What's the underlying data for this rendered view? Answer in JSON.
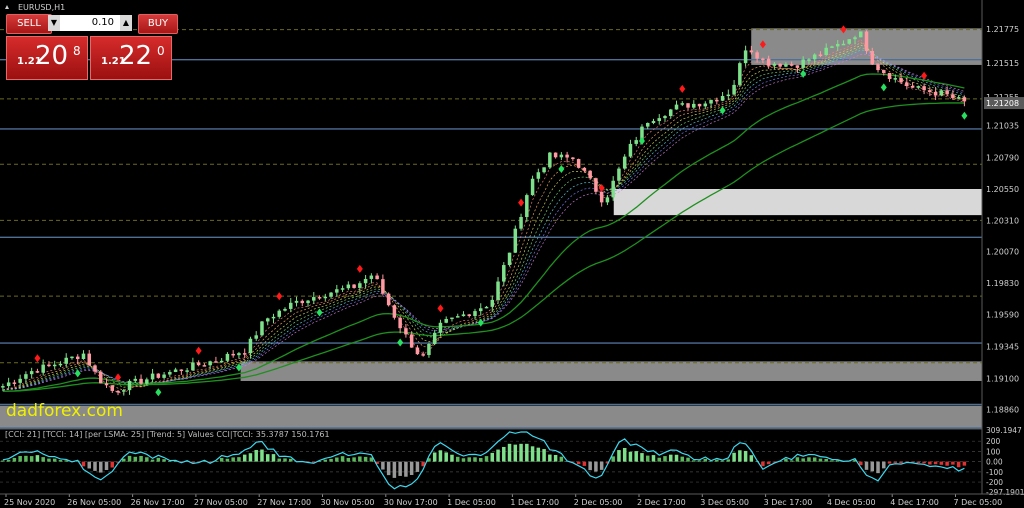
{
  "symbol_label": "EURUSD,H1",
  "watermark": "dadforex.com",
  "trade_panel": {
    "sell_label": "SELL",
    "buy_label": "BUY",
    "lot_value": "0.10",
    "sell_price_prefix": "1.21",
    "sell_price_big": "20",
    "sell_price_sup": "8",
    "buy_price_prefix": "1.21",
    "buy_price_big": "22",
    "buy_price_sup": "0",
    "arrow_down": "▼",
    "arrow_up": "▲"
  },
  "price_axis": [
    "1.21775",
    "1.21515",
    "1.21255",
    "1.21035",
    "1.20790",
    "1.20550",
    "1.20310",
    "1.20070",
    "1.19830",
    "1.19590",
    "1.19345",
    "1.19100",
    "1.18860"
  ],
  "current_price": "1.21208",
  "indicator": {
    "label": "[CCI: 21] [TCCI: 14] [per LSMA: 25] [Trend: 5] Values CCI|TCCI: 35.3787 150.1761",
    "axis_labels": [
      "309.1947",
      "200",
      "100",
      "0.00",
      "-100",
      "-200",
      "-297.1901"
    ]
  },
  "time_axis": [
    "25 Nov 2020",
    "26 Nov 05:00",
    "26 Nov 17:00",
    "27 Nov 05:00",
    "27 Nov 17:00",
    "30 Nov 05:00",
    "30 Nov 17:00",
    "1 Dec 05:00",
    "1 Dec 17:00",
    "2 Dec 05:00",
    "2 Dec 17:00",
    "3 Dec 05:00",
    "3 Dec 17:00",
    "4 Dec 05:00",
    "4 Dec 17:00",
    "7 Dec 05:00"
  ],
  "colors": {
    "background": "#000000",
    "bull_candle": "#7ee08a",
    "bear_candle": "#ff9aa2",
    "level_line": "#4e6f96",
    "dashed_level": "#6a6a20",
    "zone_fill": "#8a8a8a",
    "white_zone": "#d8d8d8",
    "sell_button": "#b11c1c",
    "cci_line": "#3cd9f0",
    "ma_green": "#1f8f1f",
    "up_marker": "#28e060",
    "down_marker": "#ff1a1a",
    "watermark": "#f0f000"
  },
  "icons": [
    "triangle-menu-icon",
    "diamond-marker-icon",
    "arrow-up-icon",
    "arrow-down-icon"
  ],
  "chart_data": {
    "type": "candlestick",
    "symbol": "EURUSD",
    "timeframe": "H1",
    "y_range": [
      1.1872,
      1.2189
    ],
    "x_labels": [
      "25 Nov 2020",
      "26 Nov 05:00",
      "26 Nov 17:00",
      "27 Nov 05:00",
      "27 Nov 17:00",
      "30 Nov 05:00",
      "30 Nov 17:00",
      "1 Dec 05:00",
      "1 Dec 17:00",
      "2 Dec 05:00",
      "2 Dec 17:00",
      "3 Dec 05:00",
      "3 Dec 17:00",
      "4 Dec 05:00",
      "4 Dec 17:00",
      "7 Dec 05:00"
    ],
    "close_path": [
      [
        0,
        1.1903
      ],
      [
        0.03,
        1.1915
      ],
      [
        0.06,
        1.1922
      ],
      [
        0.085,
        1.1929
      ],
      [
        0.1,
        1.191
      ],
      [
        0.115,
        1.19
      ],
      [
        0.13,
        1.1905
      ],
      [
        0.16,
        1.1912
      ],
      [
        0.19,
        1.1918
      ],
      [
        0.22,
        1.1924
      ],
      [
        0.25,
        1.1932
      ],
      [
        0.27,
        1.1955
      ],
      [
        0.3,
        1.1968
      ],
      [
        0.33,
        1.1975
      ],
      [
        0.36,
        1.198
      ],
      [
        0.38,
        1.199
      ],
      [
        0.4,
        1.196
      ],
      [
        0.415,
        1.194
      ],
      [
        0.43,
        1.1925
      ],
      [
        0.45,
        1.1952
      ],
      [
        0.47,
        1.1958
      ],
      [
        0.5,
        1.1968
      ],
      [
        0.52,
        1.201
      ],
      [
        0.54,
        1.206
      ],
      [
        0.56,
        1.208
      ],
      [
        0.585,
        1.2078
      ],
      [
        0.6,
        1.2062
      ],
      [
        0.615,
        1.2045
      ],
      [
        0.64,
        1.2085
      ],
      [
        0.66,
        1.2108
      ],
      [
        0.69,
        1.2118
      ],
      [
        0.72,
        1.2122
      ],
      [
        0.745,
        1.213
      ],
      [
        0.76,
        1.2165
      ],
      [
        0.78,
        1.2152
      ],
      [
        0.81,
        1.215
      ],
      [
        0.84,
        1.216
      ],
      [
        0.86,
        1.2168
      ],
      [
        0.875,
        1.2176
      ],
      [
        0.89,
        1.215
      ],
      [
        0.91,
        1.214
      ],
      [
        0.93,
        1.2132
      ],
      [
        0.96,
        1.2128
      ],
      [
        0.982,
        1.2121
      ]
    ],
    "levels_solid": [
      1.2154,
      1.2101,
      1.2018,
      1.1937,
      1.189,
      1.1872
    ],
    "levels_dashed": [
      1.2177,
      1.2124,
      1.2074,
      1.2031,
      1.1973,
      1.1922
    ],
    "zones": [
      {
        "from": 1.215,
        "to": 1.2178,
        "x_start": 0.765,
        "color": "gray"
      },
      {
        "from": 1.2035,
        "to": 1.2055,
        "x_start": 0.625,
        "color": "white"
      },
      {
        "from": 1.1908,
        "to": 1.1923,
        "x_start": 0.245,
        "color": "gray"
      },
      {
        "from": 1.1872,
        "to": 1.1889,
        "x_start": 0.0,
        "color": "gray"
      }
    ],
    "indicator": {
      "name": "CCI/TCCI",
      "cci": 35.3787,
      "tcci": 150.1761,
      "y_range": [
        -297.1901,
        309.1947
      ],
      "levels": [
        200,
        100,
        0,
        -100,
        -200
      ]
    }
  }
}
